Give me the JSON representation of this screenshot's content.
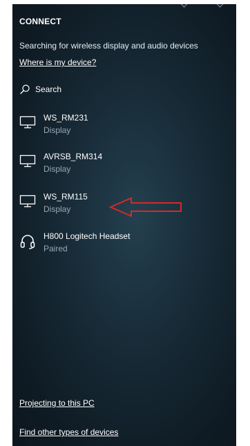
{
  "panel": {
    "title": "CONNECT",
    "status": "Searching for wireless display and audio devices",
    "where_link": "Where is my device?",
    "search": {
      "label": "Search",
      "icon": "search-icon"
    }
  },
  "devices": [
    {
      "name": "WS_RM231",
      "type": "Display",
      "icon": "monitor-icon"
    },
    {
      "name": "AVRSB_RM314",
      "type": "Display",
      "icon": "monitor-icon"
    },
    {
      "name": "WS_RM115",
      "type": "Display",
      "icon": "monitor-icon"
    },
    {
      "name": "H800 Logitech Headset",
      "type": "Paired",
      "icon": "headset-icon"
    }
  ],
  "annotation": {
    "icon": "red-arrow-icon",
    "color": "#d42a2a"
  },
  "footer": {
    "projecting_link": "Projecting to this PC",
    "other_devices_link": "Find other types of devices"
  },
  "colors": {
    "panel_background": "#172a36",
    "text_primary": "#ffffff",
    "text_secondary": "#9aa8b2"
  }
}
